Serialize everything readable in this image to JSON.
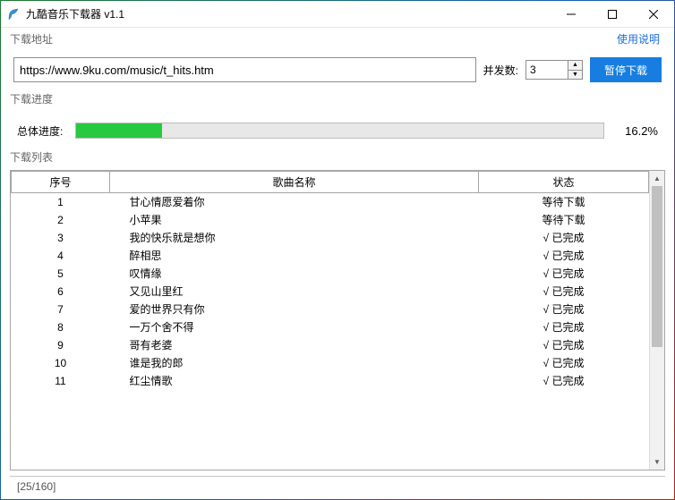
{
  "window": {
    "title": "九酷音乐下载器 v1.1"
  },
  "labels": {
    "address_group": "下载地址",
    "help": "使用说明",
    "concurrency": "并发数:",
    "action_button": "暂停下载",
    "progress_group": "下载进度",
    "overall_progress": "总体进度:",
    "list_group": "下载列表"
  },
  "address": {
    "url": "https://www.9ku.com/music/t_hits.htm",
    "concurrency": "3"
  },
  "progress": {
    "percent_text": "16.2%",
    "percent_value": 16.2
  },
  "table": {
    "headers": {
      "index": "序号",
      "name": "歌曲名称",
      "status": "状态"
    },
    "rows": [
      {
        "index": "1",
        "name": "甘心情愿爱着你",
        "status": "等待下载"
      },
      {
        "index": "2",
        "name": "小苹果",
        "status": "等待下载"
      },
      {
        "index": "3",
        "name": "我的快乐就是想你",
        "status": "√ 已完成"
      },
      {
        "index": "4",
        "name": "醉相思",
        "status": "√ 已完成"
      },
      {
        "index": "5",
        "name": "叹情缘",
        "status": "√ 已完成"
      },
      {
        "index": "6",
        "name": "又见山里红",
        "status": "√ 已完成"
      },
      {
        "index": "7",
        "name": "爱的世界只有你",
        "status": "√ 已完成"
      },
      {
        "index": "8",
        "name": "一万个舍不得",
        "status": "√ 已完成"
      },
      {
        "index": "9",
        "name": "哥有老婆",
        "status": "√ 已完成"
      },
      {
        "index": "10",
        "name": "谁是我的郎",
        "status": "√ 已完成"
      },
      {
        "index": "11",
        "name": "红尘情歌",
        "status": "√ 已完成"
      }
    ]
  },
  "statusbar": {
    "text": "[25/160]"
  }
}
